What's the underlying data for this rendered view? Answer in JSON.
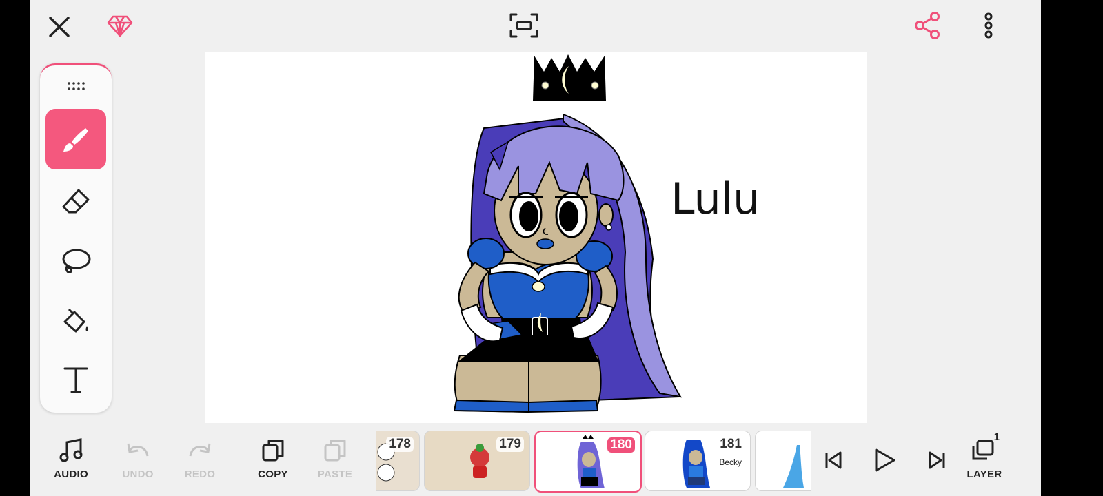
{
  "toolbar": {
    "close_icon": "close-icon",
    "premium_icon": "diamond-icon",
    "fullscreen_icon": "fullscreen-icon",
    "share_icon": "share-icon",
    "menu_icon": "more-vertical-icon",
    "accent_color": "#f0507a"
  },
  "tools": [
    {
      "name": "brush",
      "icon": "brush-icon",
      "active": true
    },
    {
      "name": "eraser",
      "icon": "eraser-icon",
      "active": false
    },
    {
      "name": "lasso",
      "icon": "lasso-icon",
      "active": false
    },
    {
      "name": "fill",
      "icon": "paint-bucket-icon",
      "active": false
    },
    {
      "name": "text",
      "icon": "text-icon",
      "active": false
    }
  ],
  "canvas": {
    "caption": "Lulu"
  },
  "bottom": {
    "audio_label": "AUDIO",
    "undo_label": "UNDO",
    "redo_label": "REDO",
    "copy_label": "COPY",
    "paste_label": "PASTE",
    "layer_label": "LAYER",
    "layer_count": "1"
  },
  "frames": [
    {
      "number": "178",
      "subtitle": ""
    },
    {
      "number": "179",
      "subtitle": ""
    },
    {
      "number": "180",
      "subtitle": "",
      "selected": true
    },
    {
      "number": "181",
      "subtitle": "Becky"
    },
    {
      "number": "",
      "subtitle": ""
    }
  ]
}
